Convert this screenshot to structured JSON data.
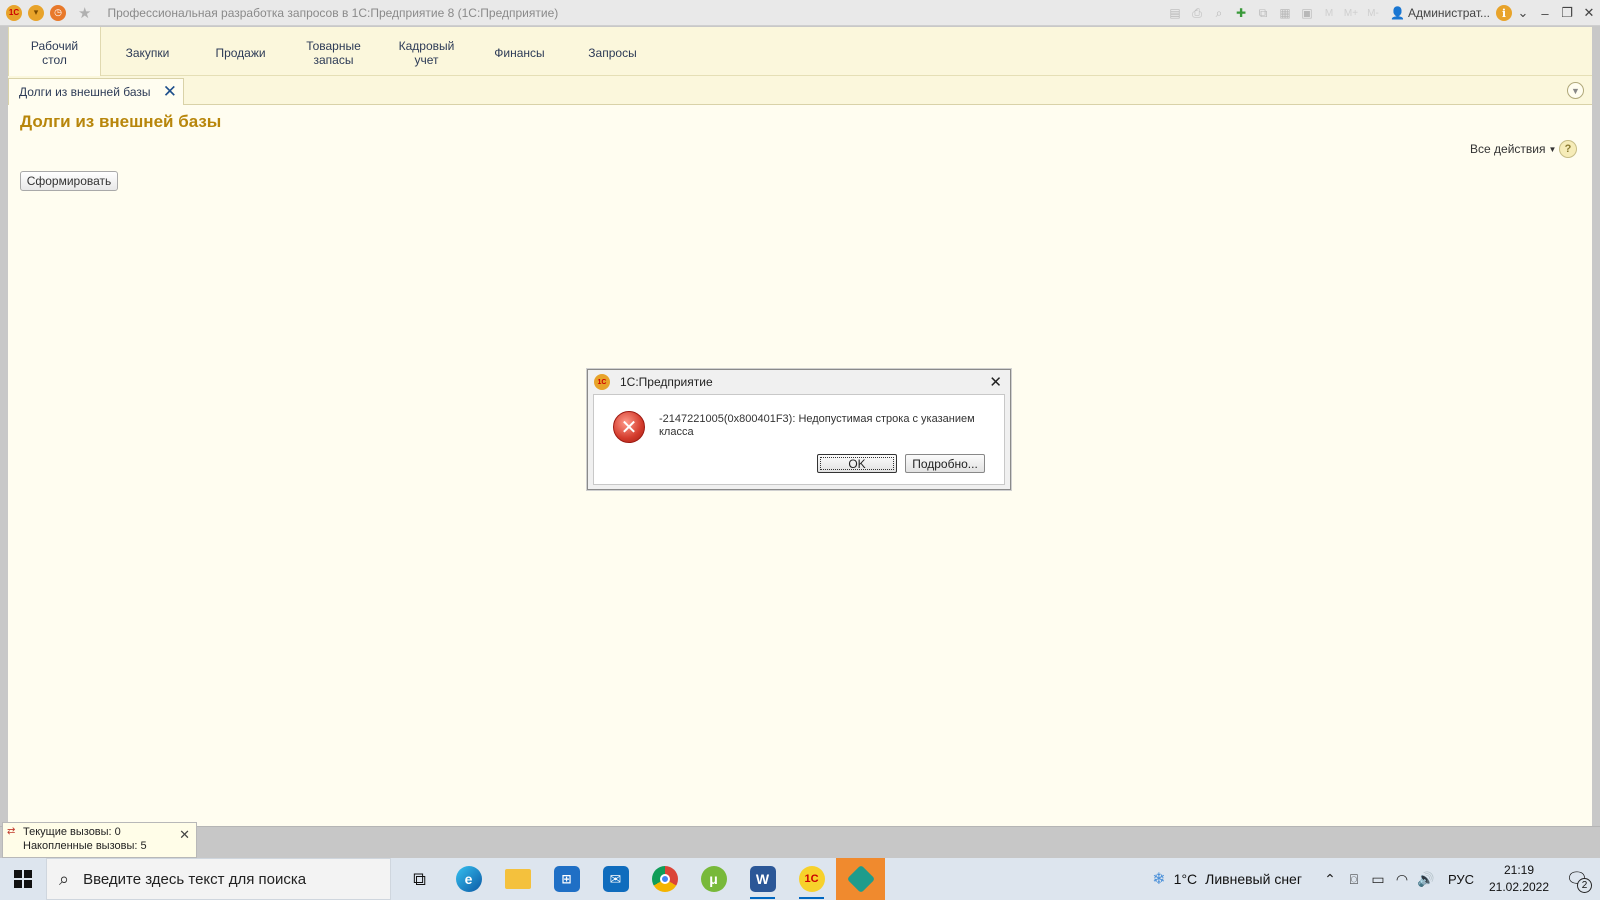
{
  "app": {
    "window_title": "Профессиональная разработка запросов в 1С:Предприятие 8  (1С:Предприятие)",
    "user": "Администрат...",
    "logo_text": "1С"
  },
  "sections": [
    {
      "label": "Рабочий стол",
      "active": true
    },
    {
      "label": "Закупки"
    },
    {
      "label": "Продажи"
    },
    {
      "label": "Товарные запасы"
    },
    {
      "label": "Кадровый учет"
    },
    {
      "label": "Финансы"
    },
    {
      "label": "Запросы"
    }
  ],
  "open_windows": {
    "tab_label": "Долги из внешней базы",
    "close_glyph": "✕"
  },
  "form": {
    "title": "Долги из внешней базы",
    "all_actions": "Все действия",
    "generate_button": "Сформировать",
    "help": "?"
  },
  "dialog": {
    "title": "1С:Предприятие",
    "message": "-2147221005(0x800401F3): Недопустимая строка с указанием класса",
    "ok_button": "OK",
    "details_button": "Подробно..."
  },
  "perf": {
    "current_calls": "Текущие вызовы: 0",
    "accumulated_calls": "Накопленные вызовы: 5"
  },
  "taskbar": {
    "search_placeholder": "Введите здесь текст для поиска",
    "weather_temp": "1°C",
    "weather_desc": "Ливневый снег",
    "language": "РУС",
    "time": "21:19",
    "date": "21.02.2022",
    "notification_count": "2",
    "apps": [
      {
        "icon": "task-view-icon"
      },
      {
        "icon": "edge-icon"
      },
      {
        "icon": "file-explorer-icon"
      },
      {
        "icon": "microsoft-store-icon"
      },
      {
        "icon": "mail-icon"
      },
      {
        "icon": "chrome-icon"
      },
      {
        "icon": "utorrent-icon"
      },
      {
        "icon": "word-icon"
      },
      {
        "icon": "1c-icon"
      },
      {
        "icon": "1c-configurator-icon"
      }
    ]
  },
  "colors": {
    "title_accent": "#b8860b",
    "panel_bg": "#fbf7dc",
    "work_bg": "#fffdf0",
    "active_task": "#f08a2e"
  }
}
